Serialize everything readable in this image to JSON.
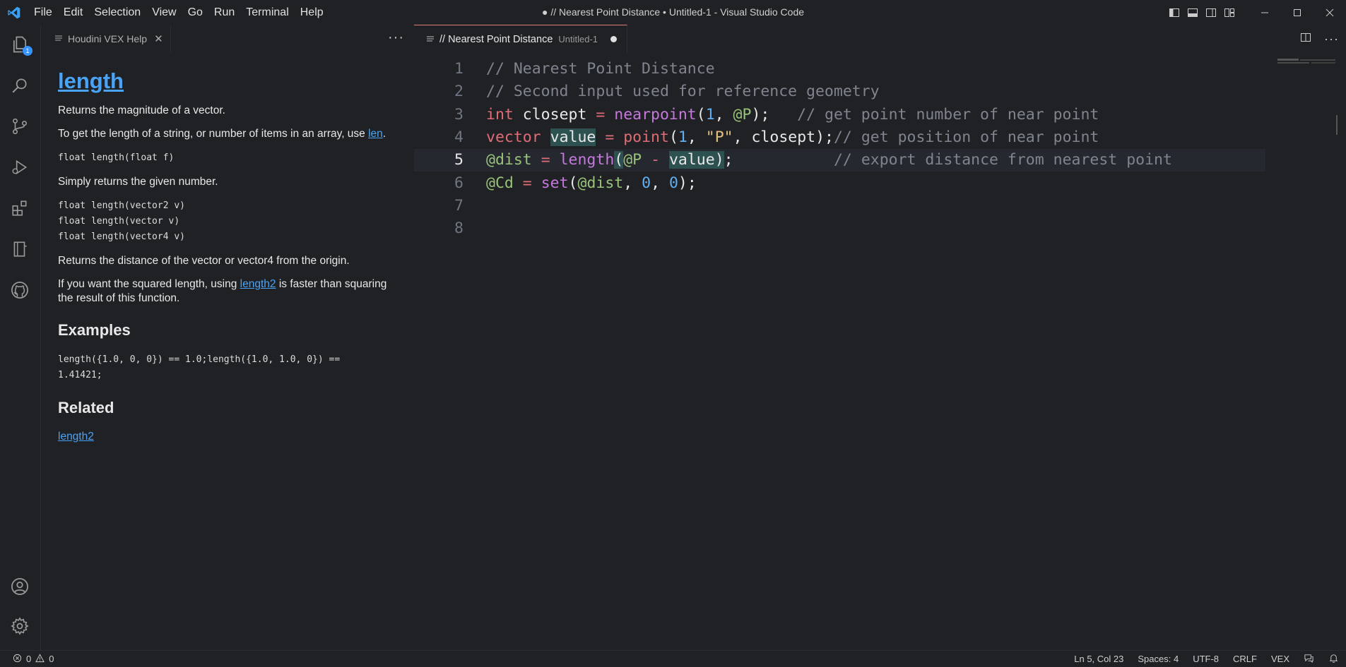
{
  "window": {
    "title": "● // Nearest Point Distance • Untitled-1 - Visual Studio Code"
  },
  "menu": [
    "File",
    "Edit",
    "Selection",
    "View",
    "Go",
    "Run",
    "Terminal",
    "Help"
  ],
  "activity_bar": {
    "explorer_badge": "1"
  },
  "sidebar": {
    "tab_label": "Houdini VEX Help",
    "help": {
      "title": "length",
      "p1": "Returns the magnitude of a vector.",
      "p2_before": "To get the length of a string, or number of items in an array, use ",
      "p2_link": "len",
      "p2_after": ".",
      "sig1": "float length(float f)",
      "p3": "Simply returns the given number.",
      "sig2": "float length(vector2 v)\nfloat length(vector v)\nfloat length(vector4 v)",
      "p4": "Returns the distance of the vector or vector4 from the origin.",
      "p5_before": "If you want the squared length, using ",
      "p5_link": "length2",
      "p5_after": " is faster than squaring the result of this function.",
      "examples_heading": "Examples",
      "example_code": "length({1.0, 0, 0}) == 1.0;length({1.0, 1.0, 0}) ==\n1.41421;",
      "related_heading": "Related",
      "related_link": "length2"
    }
  },
  "editor": {
    "tab_name": "// Nearest Point Distance",
    "tab_desc": "Untitled-1",
    "lines": [
      {
        "n": "1",
        "tokens": [
          [
            "cm",
            "// Nearest Point Distance"
          ]
        ]
      },
      {
        "n": "2",
        "tokens": [
          [
            "cm",
            "// Second input used for reference geometry"
          ]
        ]
      },
      {
        "n": "3",
        "tokens": [
          [
            "kw",
            "int"
          ],
          [
            "pl",
            " closept "
          ],
          [
            "kw",
            "="
          ],
          [
            "pl",
            " "
          ],
          [
            "fn",
            "nearpoint"
          ],
          [
            "pl",
            "("
          ],
          [
            "num",
            "1"
          ],
          [
            "pl",
            ", "
          ],
          [
            "at",
            "@P"
          ],
          [
            "pl",
            ");   "
          ],
          [
            "cm",
            "// get point number of near point"
          ]
        ]
      },
      {
        "n": "4",
        "tokens": [
          [
            "kw",
            "vector"
          ],
          [
            "pl",
            " "
          ],
          [
            "hlpl",
            "value"
          ],
          [
            "pl",
            " "
          ],
          [
            "kw",
            "="
          ],
          [
            "pl",
            " "
          ],
          [
            "kw",
            "point"
          ],
          [
            "pl",
            "("
          ],
          [
            "num",
            "1"
          ],
          [
            "pl",
            ", "
          ],
          [
            "str",
            "\"P\""
          ],
          [
            "pl",
            ", closept);"
          ],
          [
            "cm",
            "// get position of near point"
          ]
        ]
      },
      {
        "n": "5",
        "current": true,
        "tokens": [
          [
            "at",
            "@dist"
          ],
          [
            "pl",
            " "
          ],
          [
            "kw",
            "="
          ],
          [
            "pl",
            " "
          ],
          [
            "fn",
            "length"
          ],
          [
            "hlpl",
            "("
          ],
          [
            "at",
            "@P"
          ],
          [
            "pl",
            " "
          ],
          [
            "kw",
            "-"
          ],
          [
            "pl",
            " "
          ],
          [
            "hlpl",
            "value)"
          ],
          [
            "pl",
            ";           "
          ],
          [
            "cm",
            "// export distance from nearest point"
          ]
        ]
      },
      {
        "n": "6",
        "tokens": [
          [
            "at",
            "@Cd"
          ],
          [
            "pl",
            " "
          ],
          [
            "kw",
            "="
          ],
          [
            "pl",
            " "
          ],
          [
            "fn",
            "set"
          ],
          [
            "pl",
            "("
          ],
          [
            "at",
            "@dist"
          ],
          [
            "pl",
            ", "
          ],
          [
            "num",
            "0"
          ],
          [
            "pl",
            ", "
          ],
          [
            "num",
            "0"
          ],
          [
            "pl",
            ");"
          ]
        ]
      },
      {
        "n": "7",
        "tokens": []
      },
      {
        "n": "8",
        "tokens": []
      }
    ]
  },
  "status": {
    "errors": "0",
    "warnings": "0",
    "position": "Ln 5, Col 23",
    "spaces": "Spaces: 4",
    "encoding": "UTF-8",
    "eol": "CRLF",
    "language": "VEX"
  }
}
